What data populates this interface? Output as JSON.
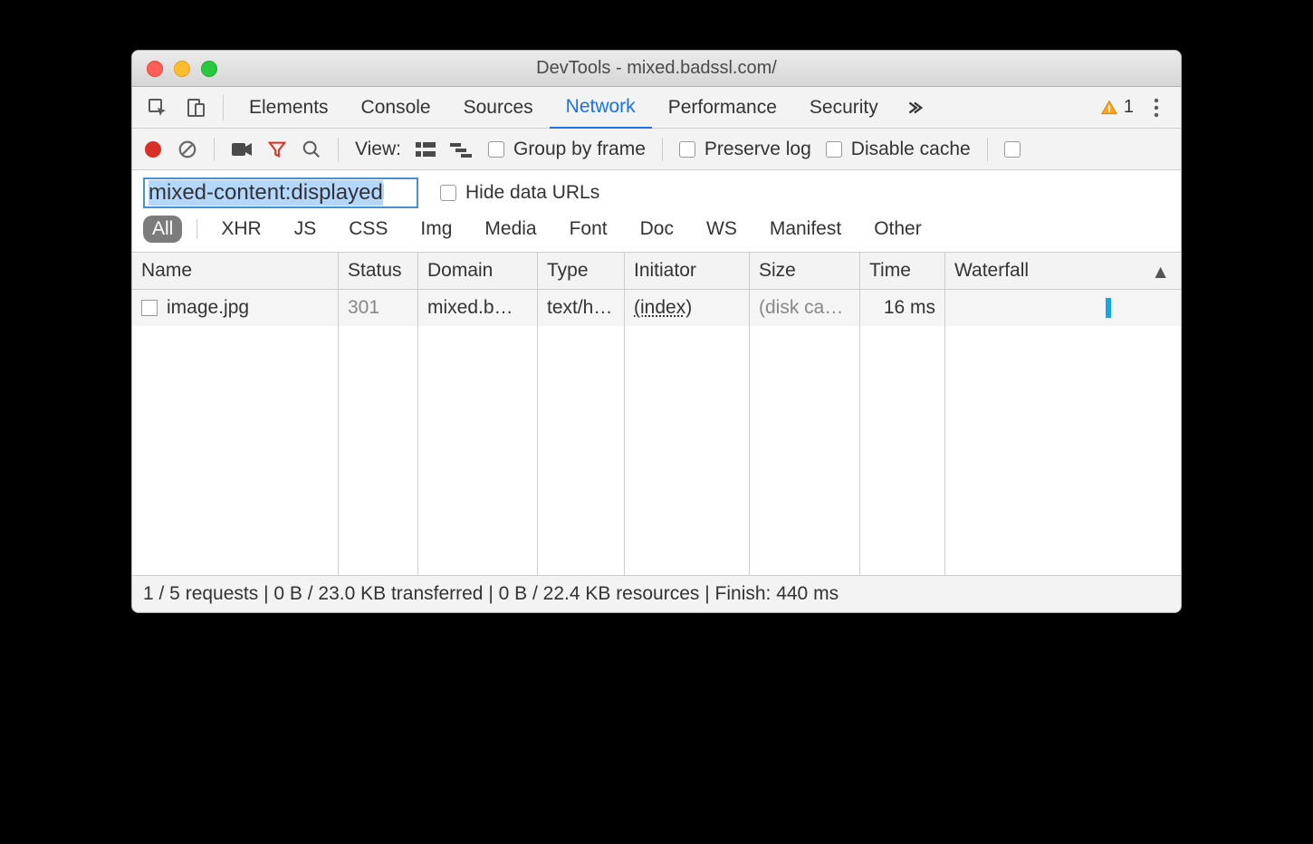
{
  "window": {
    "title": "DevTools - mixed.badssl.com/"
  },
  "tabs": {
    "items": [
      "Elements",
      "Console",
      "Sources",
      "Network",
      "Performance",
      "Security"
    ],
    "active_index": 3,
    "warning_count": "1"
  },
  "toolbar": {
    "view_label": "View:",
    "group_by_frame": "Group by frame",
    "preserve_log": "Preserve log",
    "disable_cache": "Disable cache"
  },
  "filter": {
    "value": "mixed-content:displayed",
    "hide_data_urls": "Hide data URLs"
  },
  "type_filters": {
    "items": [
      "All",
      "XHR",
      "JS",
      "CSS",
      "Img",
      "Media",
      "Font",
      "Doc",
      "WS",
      "Manifest",
      "Other"
    ],
    "active_index": 0
  },
  "table": {
    "headers": [
      "Name",
      "Status",
      "Domain",
      "Type",
      "Initiator",
      "Size",
      "Time",
      "Waterfall"
    ],
    "sort_column": 7,
    "rows": [
      {
        "name": "image.jpg",
        "status": "301",
        "domain": "mixed.b…",
        "type": "text/h…",
        "initiator": "(index)",
        "size": "(disk ca…",
        "time": "16 ms"
      }
    ]
  },
  "statusbar": {
    "text": "1 / 5 requests | 0 B / 23.0 KB transferred | 0 B / 22.4 KB resources | Finish: 440 ms"
  }
}
